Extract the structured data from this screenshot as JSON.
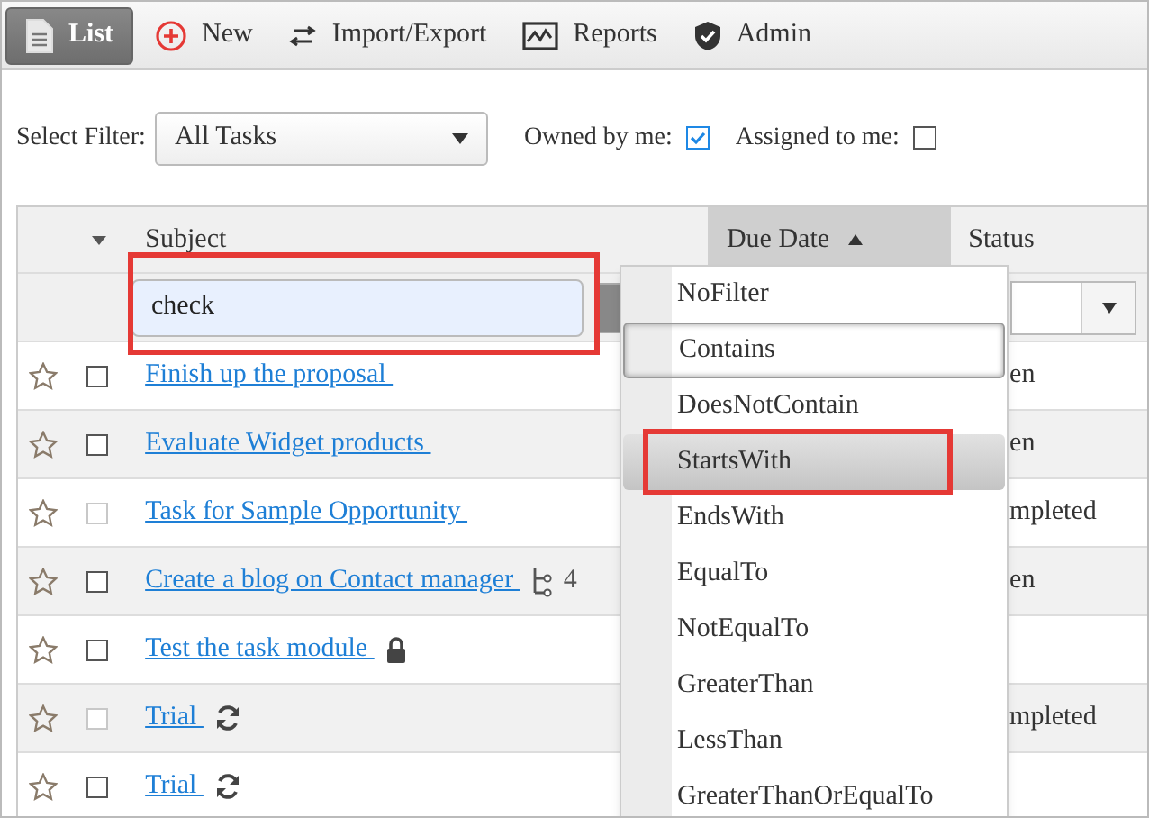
{
  "toolbar": [
    {
      "label": "List",
      "selected": true
    },
    {
      "label": "New",
      "selected": false
    },
    {
      "label": "Import/Export",
      "selected": false
    },
    {
      "label": "Reports",
      "selected": false
    },
    {
      "label": "Admin",
      "selected": false
    }
  ],
  "filter_bar": {
    "label": "Select Filter:",
    "value": "All Tasks",
    "owned_label": "Owned by me:",
    "owned_checked": true,
    "assigned_label": "Assigned to me:",
    "assigned_checked": false
  },
  "grid": {
    "columns": [
      {
        "label": "Subject",
        "sorted": false
      },
      {
        "label": "Due Date",
        "sorted": true
      },
      {
        "label": "Status",
        "sorted": false
      }
    ],
    "subject_filter": {
      "value": "check",
      "highlighted": true
    },
    "rows": [
      {
        "subject": "Finish up the proposal",
        "starred": false,
        "disabled": false,
        "locked": false,
        "recurring": false,
        "status": "en"
      },
      {
        "subject": "Evaluate Widget products",
        "starred": false,
        "disabled": false,
        "locked": false,
        "recurring": false,
        "status": "en"
      },
      {
        "subject": "Task for Sample Opportunity",
        "starred": false,
        "disabled": true,
        "locked": false,
        "recurring": false,
        "status": "mpleted"
      },
      {
        "subject": "Create a blog on Contact manager",
        "starred": false,
        "disabled": false,
        "locked": false,
        "recurring": false,
        "subtask_count": "4",
        "status": "en"
      },
      {
        "subject": "Test the task module",
        "starred": false,
        "disabled": false,
        "locked": true,
        "recurring": false
      },
      {
        "subject": "Trial",
        "starred": false,
        "disabled": true,
        "locked": false,
        "recurring": true,
        "status": "mpleted"
      },
      {
        "subject": "Trial",
        "starred": false,
        "disabled": false,
        "locked": false,
        "recurring": true
      }
    ]
  },
  "filter_menu": [
    {
      "label": "NoFilter",
      "selected": false,
      "hovered": false,
      "highlighted": false
    },
    {
      "label": "Contains",
      "selected": true,
      "hovered": false,
      "highlighted": false
    },
    {
      "label": "DoesNotContain",
      "selected": false,
      "hovered": false,
      "highlighted": false
    },
    {
      "label": "StartsWith",
      "selected": false,
      "hovered": true,
      "highlighted": true
    },
    {
      "label": "EndsWith",
      "selected": false,
      "hovered": false,
      "highlighted": false
    },
    {
      "label": "EqualTo",
      "selected": false,
      "hovered": false,
      "highlighted": false
    },
    {
      "label": "NotEqualTo",
      "selected": false,
      "hovered": false,
      "highlighted": false
    },
    {
      "label": "GreaterThan",
      "selected": false,
      "hovered": false,
      "highlighted": false
    },
    {
      "label": "LessThan",
      "selected": false,
      "hovered": false,
      "highlighted": false
    },
    {
      "label": "GreaterThanOrEqualTo",
      "selected": false,
      "hovered": false,
      "highlighted": false
    }
  ]
}
